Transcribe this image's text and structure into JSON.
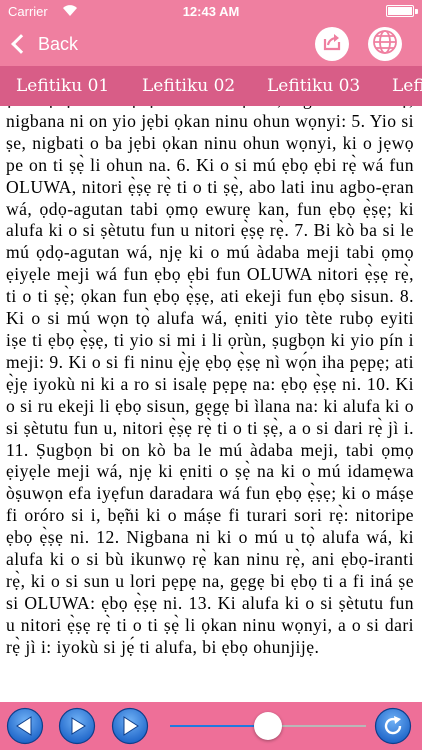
{
  "status_bar": {
    "carrier": "Carrier",
    "time": "12:43 AM"
  },
  "nav": {
    "back_label": "Back"
  },
  "tabs": [
    "Lefitiku 01",
    "Lefitiku 02",
    "Lefitiku 03",
    "Lefi"
  ],
  "content": {
    "text": "ṣe si ẹbọ sisun: ẹbọ ti a fi iná ṣe ni, nigbati o ba mọ̀, nigbana ni on yio jẹbi ọkan ninu ohun wọnyi: 5. Yio si ṣe, nigbati o ba jẹbi ọkan ninu ohun wọnyi, ki o jẹwọ pe on ti ṣẹ̀ li ohun na. 6. Ki o si mú ẹbọ ẹbi rẹ̀ wá fun OLUWA, nitori ẹ̀ṣẹ rẹ̀ ti o ti ṣẹ̀, abo lati inu agbo-ẹran wá, ọdọ-agutan tabi ọmọ ewurẹ kan, fun ẹbọ ẹ̀ṣẹ; ki alufa ki o si ṣètutu fun u nitori ẹ̀ṣẹ rẹ̀. 7. Bi kò ba si le mú ọdọ-agutan wá, njẹ ki o mú àdaba meji tabi ọmọ ẹiyẹle meji wá fun ẹbọ ẹbi fun OLUWA nitori ẹ̀ṣẹ rẹ̀, ti o ti ṣẹ̀; ọkan fun ẹbọ ẹ̀ṣẹ, ati ekeji fun ẹbọ sisun. 8. Ki o si mú wọn tọ̀ alufa wá, ẹniti yio tète rubọ eyiti iṣe ti ẹbọ ẹ̀ṣẹ, ti yio si mi i li ọrùn, ṣugbọn ki yio pín i meji: 9. Ki o si fi ninu ẹ̀jẹ ẹbọ ẹ̀ṣẹ nì wọ́n iha pẹpẹ; ati ẹ̀jẹ iyokù ni ki a ro si isalẹ pẹpẹ na: ẹbọ ẹ̀ṣẹ ni. 10. Ki o si ru ekeji li ẹbọ sisun, gẹgẹ bi ìlana na: ki alufa ki o si ṣètutu fun u, nitori ẹ̀ṣẹ rẹ̀ ti o ti ṣẹ̀, a o si dari rẹ̀ jì i. 11. Ṣugbọn bi on kò ba le mú àdaba meji, tabi ọmọ ẹiyẹle meji wá, njẹ ki ẹniti o ṣẹ̀ na ki o mú idamẹwa òṣuwọn efa iyẹfun daradara wá fun ẹbọ ẹ̀ṣẹ; ki o máṣe fi oróro si i, bẹ̃ni ki o máṣe fi turari sori rẹ̀: nitoripe ẹbọ ẹ̀ṣẹ ni. 12. Nigbana ni ki o mú u tọ̀ alufa wá, ki alufa ki o si bù ikunwọ rẹ̀ kan ninu rẹ̀, ani ẹbọ-iranti rẹ̀, ki o si sun u lori pẹpẹ na, gẹgẹ bi ẹbọ ti a fi iná ṣe si OLUWA: ẹbọ ẹ̀ṣẹ ni. 13. Ki alufa ki o si ṣètutu fun u nitori ẹ̀ṣẹ rẹ̀ ti o ti ṣẹ̀ li ọkan ninu wọnyi, a o si dari rẹ̀ jì i: iyokù si jẹ́ ti alufa, bi ẹbọ ohunjijẹ."
  },
  "player": {
    "progress": 0.5
  },
  "icons": {
    "share": "share-icon",
    "globe": "globe-icon",
    "previous": "previous-icon",
    "play": "play-icon",
    "next": "next-icon",
    "refresh": "refresh-icon"
  },
  "colors": {
    "header_pink": "#ef7fa0",
    "tab_pink": "#d85d87",
    "toolbar_pink": "#ee6f98",
    "accent_blue": "#1f7ae0"
  }
}
